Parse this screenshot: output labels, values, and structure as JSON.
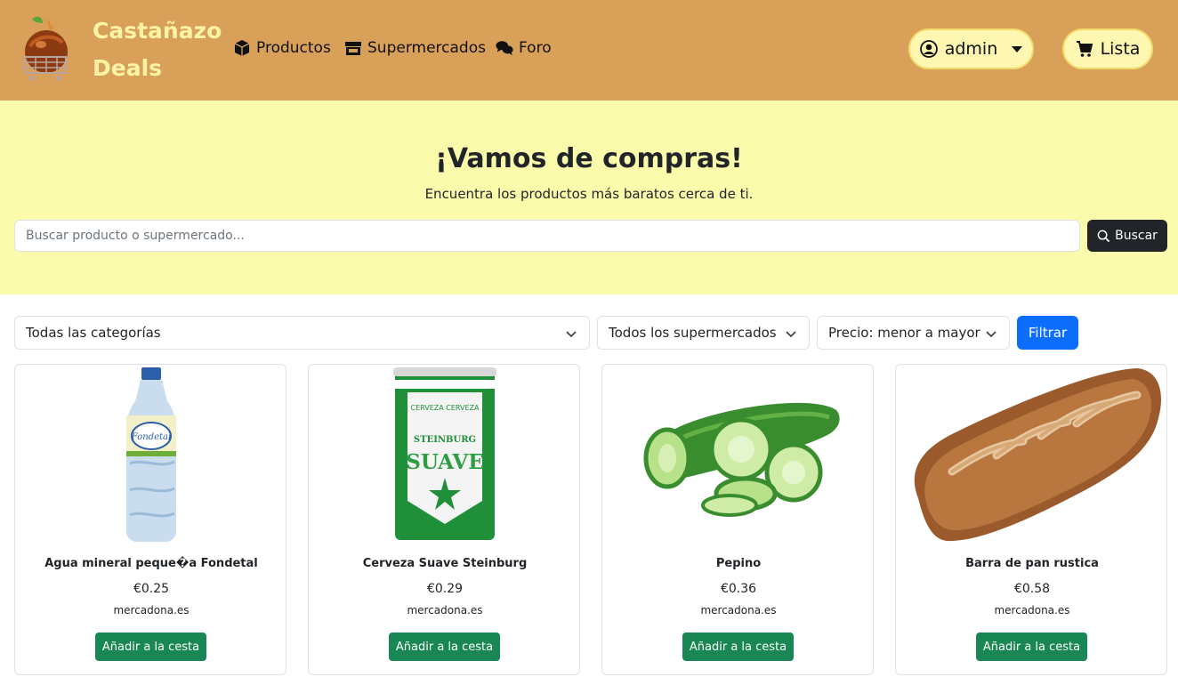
{
  "navbar": {
    "brand_line1": "Castañazo",
    "brand_line2": "Deals",
    "links": [
      {
        "label": "Productos",
        "icon": "box-icon"
      },
      {
        "label": "Supermercados",
        "icon": "store-icon"
      },
      {
        "label": "Foro",
        "icon": "comments-icon"
      }
    ],
    "user_label": "admin",
    "cart_label": "Lista"
  },
  "hero": {
    "title": "¡Vamos de compras!",
    "subtitle": "Encuentra los productos más baratos cerca de ti.",
    "search_placeholder": "Buscar producto o supermercado...",
    "search_button": "Buscar"
  },
  "filters": {
    "category": "Todas las categorías",
    "supermarket": "Todos los supermercados",
    "sort": "Precio: menor a mayor",
    "filter_button": "Filtrar"
  },
  "products": [
    {
      "name": "Agua mineral peque�a Fondetal",
      "price": "€0.25",
      "store": "mercadona.es",
      "button": "Añadir a la cesta"
    },
    {
      "name": "Cerveza Suave Steinburg",
      "price": "€0.29",
      "store": "mercadona.es",
      "button": "Añadir a la cesta"
    },
    {
      "name": "Pepino",
      "price": "€0.36",
      "store": "mercadona.es",
      "button": "Añadir a la cesta"
    },
    {
      "name": "Barra de pan rustica",
      "price": "€0.58",
      "store": "mercadona.es",
      "button": "Añadir a la cesta"
    }
  ],
  "colors": {
    "navbar": "#d9a05a",
    "hero": "#fbfbac",
    "brand_text": "#fdf3a6",
    "primary": "#0d6efd",
    "success": "#198754",
    "dark": "#212529"
  }
}
